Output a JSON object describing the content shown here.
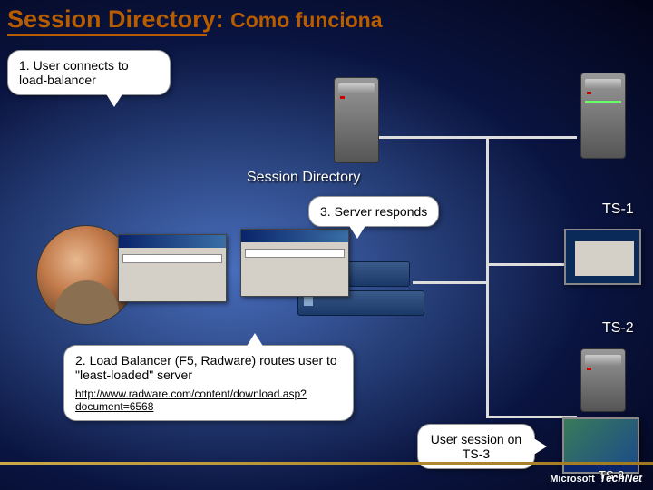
{
  "title_main": "Session Directory:",
  "title_sub": "Como funciona",
  "callouts": {
    "step1": "1. User connects to load-balancer",
    "step2_a": "2. Load Balancer (F5, Radware) routes user to \"least-loaded\" server",
    "step2_link": "http://www.radware.com/content/download.asp?document=6568",
    "step3": "3. Server responds",
    "user_session": "User session on TS-3"
  },
  "labels": {
    "session_directory": "Session Directory",
    "ts1": "TS-1",
    "ts2": "TS-2",
    "ts3": "TS-3"
  },
  "footer": {
    "brand": "Microsoft",
    "product": "TechNet"
  }
}
